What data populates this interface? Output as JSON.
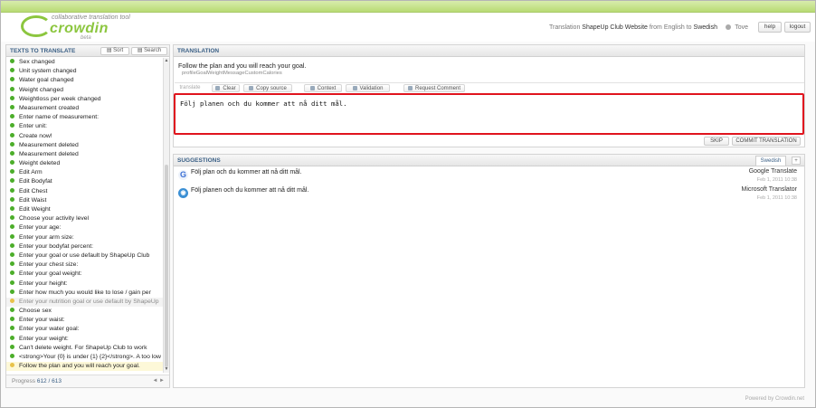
{
  "header": {
    "tagline": "collaborative translation tool",
    "logo_text": "crowdin",
    "beta": "beta",
    "info_prefix": "Translation",
    "project": "ShapeUp Club Website",
    "info_mid": "from English to",
    "target_language": "Swedish",
    "user": "Tove",
    "help_label": "help",
    "logout_label": "logout"
  },
  "left_panel": {
    "title": "TEXTS TO TRANSLATE",
    "sort_label": "Sort",
    "search_label": "Search",
    "progress_label": "Progress",
    "progress_value": "612 / 613",
    "nav": "◄ ►",
    "items": [
      {
        "text": "Sex changed",
        "state": "done"
      },
      {
        "text": "Unit system changed",
        "state": "done"
      },
      {
        "text": "Water goal changed",
        "state": "done"
      },
      {
        "text": "Weight changed",
        "state": "done"
      },
      {
        "text": "Weightloss per week changed",
        "state": "done"
      },
      {
        "text": "Measurement created",
        "state": "done"
      },
      {
        "text": "Enter name of measurement:",
        "state": "done"
      },
      {
        "text": "Enter unit:",
        "state": "done"
      },
      {
        "text": "Create now!",
        "state": "done"
      },
      {
        "text": "Measurement deleted",
        "state": "done"
      },
      {
        "text": "Measurement deleted",
        "state": "done"
      },
      {
        "text": "Weight deleted",
        "state": "done"
      },
      {
        "text": "Edit Arm",
        "state": "done"
      },
      {
        "text": "Edit Bodyfat",
        "state": "done"
      },
      {
        "text": "Edit Chest",
        "state": "done"
      },
      {
        "text": "Edit Waist",
        "state": "done"
      },
      {
        "text": "Edit Weight",
        "state": "done"
      },
      {
        "text": "Choose your activity level",
        "state": "done"
      },
      {
        "text": "Enter your age:",
        "state": "done"
      },
      {
        "text": "Enter your arm size:",
        "state": "done"
      },
      {
        "text": "Enter your bodyfat percent:",
        "state": "done"
      },
      {
        "text": "Enter your goal or use default by ShapeUp Club",
        "state": "done"
      },
      {
        "text": "Enter your chest size:",
        "state": "done"
      },
      {
        "text": "Enter your goal weight:",
        "state": "done"
      },
      {
        "text": "Enter your height:",
        "state": "done"
      },
      {
        "text": "Enter how much you would like to lose / gain per",
        "state": "done"
      },
      {
        "text": "Enter your nutrition goal or use default by ShapeUp",
        "state": "pending"
      },
      {
        "text": "Choose sex",
        "state": "done"
      },
      {
        "text": "Enter your waist:",
        "state": "done"
      },
      {
        "text": "Enter your water goal:",
        "state": "done"
      },
      {
        "text": "Enter your weight:",
        "state": "done"
      },
      {
        "text": "Can't delete weight. For ShapeUp Club to work",
        "state": "done"
      },
      {
        "text": "<strong>Your {0} is under {1} {2}</strong>. A too low",
        "state": "done"
      },
      {
        "text": "Follow the plan and you will reach your goal.",
        "state": "active"
      }
    ]
  },
  "translation": {
    "title": "TRANSLATION",
    "source_text": "Follow the plan and you will reach your goal.",
    "string_key": "profileGoalWeightMessageCustomCalories",
    "tabs": {
      "translate": "translate",
      "clear": "Clear",
      "copy_source": "Copy source",
      "context": "Context",
      "validation": "Validation",
      "request_comment": "Request Comment"
    },
    "value": "Följ planen och du kommer att nå ditt mål.",
    "skip_label": "SKIP",
    "commit_label": "COMMIT TRANSLATION"
  },
  "suggestions": {
    "title": "SUGGESTIONS",
    "language_tab": "Swedish",
    "plus": "+",
    "items": [
      {
        "text": "Följ plan och du kommer att nå ditt mål.",
        "engine": "Google Translate",
        "date": "Feb 1, 2011 10:38",
        "icon": "google-icon"
      },
      {
        "text": "Följ planen och du kommer att nå ditt mål.",
        "engine": "Microsoft Translator",
        "date": "Feb 1, 2011 10:38",
        "icon": "microsoft-icon"
      }
    ]
  },
  "footer": {
    "powered": "Powered by Crowdin.net"
  },
  "colors": {
    "accent": "#8cc63f",
    "editor_border": "#e0141e",
    "title_blue": "#3a5f85"
  }
}
